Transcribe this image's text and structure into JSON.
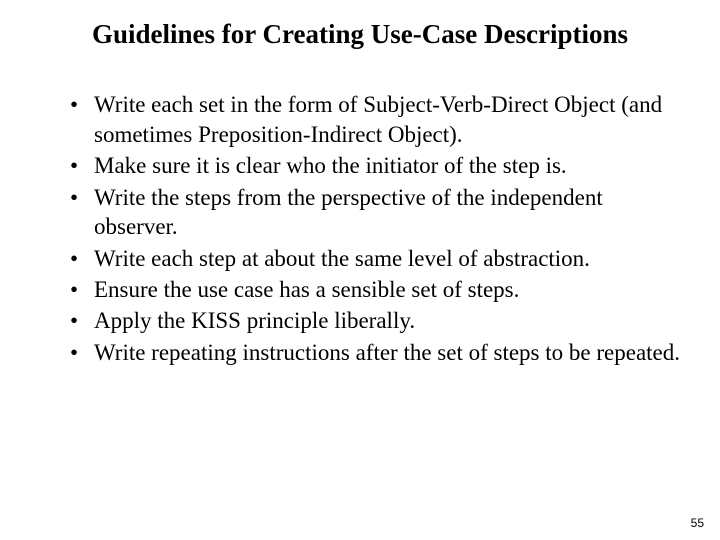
{
  "title": "Guidelines for Creating Use-Case Descriptions",
  "bullets": [
    "Write each set in the form of Subject-Verb-Direct Object (and sometimes Preposition-Indirect Object).",
    "Make sure it is clear who the initiator of the step is.",
    "Write the steps from the perspective of the independent observer.",
    "Write each step at about the same level of abstraction.",
    "Ensure the use case has a sensible set of steps.",
    "Apply the KISS principle liberally.",
    "Write repeating instructions after the set of steps to be repeated."
  ],
  "pageNumber": "55"
}
